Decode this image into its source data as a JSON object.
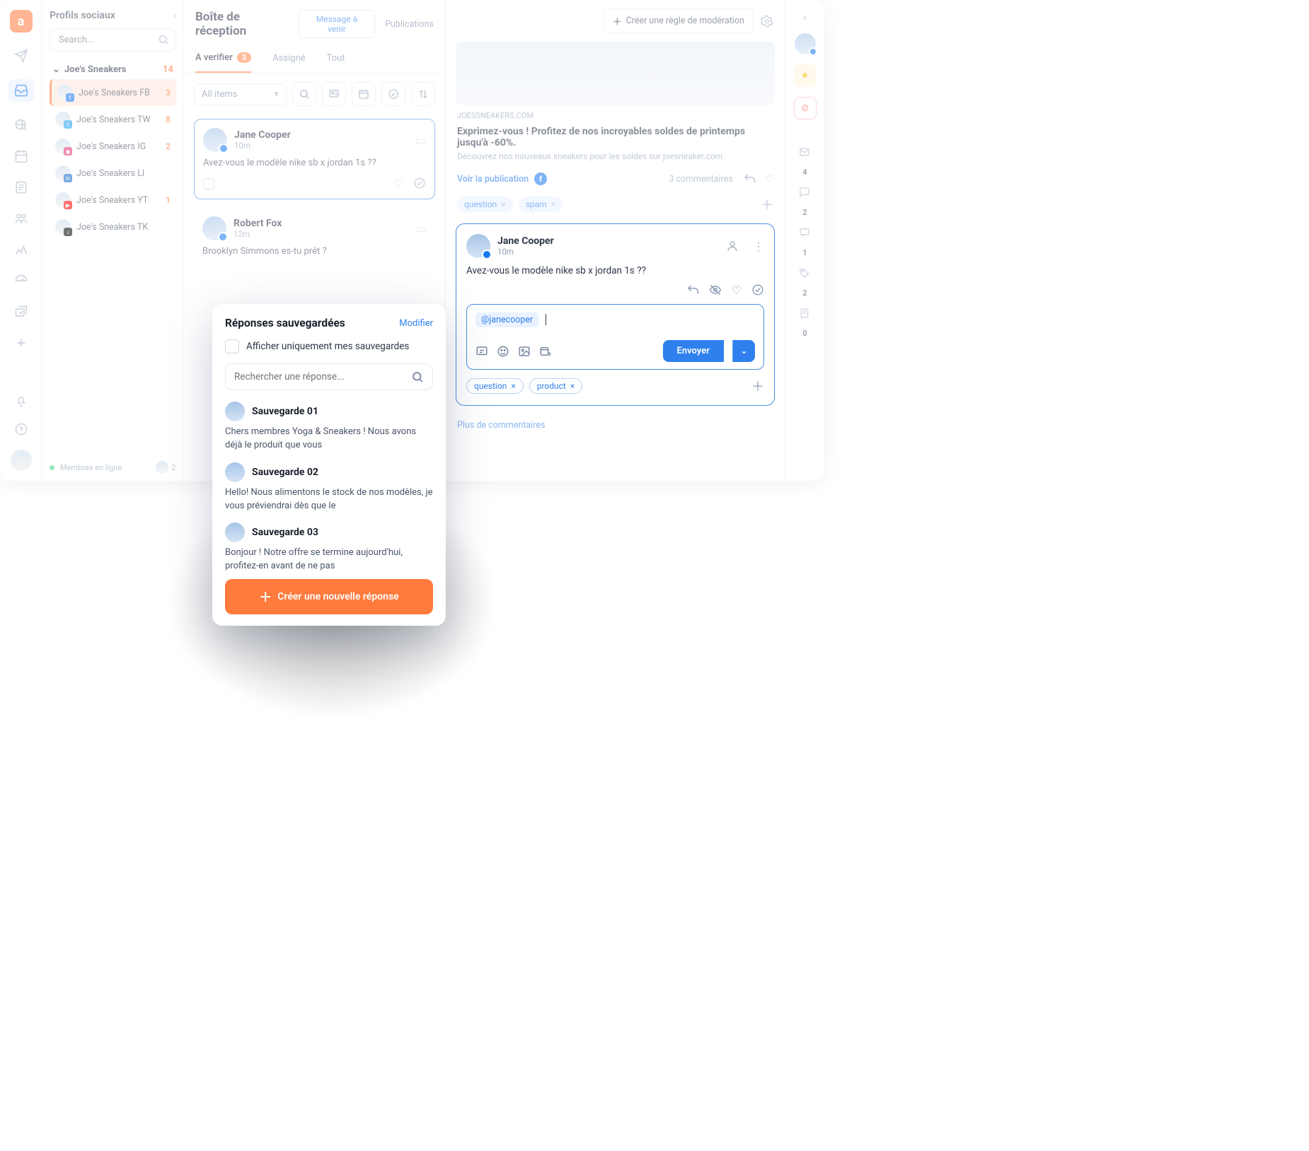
{
  "sidebar": {
    "title": "Profils sociaux",
    "search_placeholder": "Search...",
    "group": {
      "name": "Joe's Sneakers",
      "count": "14"
    },
    "items": [
      {
        "label": "Joe's Sneakers FB",
        "count": "3",
        "net": "fb"
      },
      {
        "label": "Joe's Sneakers TW",
        "count": "8",
        "net": "tw"
      },
      {
        "label": "Joe's Sneakers IG",
        "count": "2",
        "net": "ig"
      },
      {
        "label": "Joe's Sneakers LI",
        "count": "",
        "net": "li"
      },
      {
        "label": "Joe's Sneakers YT",
        "count": "1",
        "net": "yt"
      },
      {
        "label": "Joe's Sneakers TK",
        "count": "",
        "net": "tk"
      }
    ],
    "members_label": "Membres en ligne",
    "members_count": "2"
  },
  "header": {
    "title": "Boîte de réception",
    "btn_upcoming": "Message à venir",
    "tab_publications": "Publications",
    "btn_rule": "Créer une règle de modération"
  },
  "tabs": {
    "verify": "A verifier",
    "verify_count": "3",
    "assigned": "Assigné",
    "all": "Tout"
  },
  "filter": {
    "all_items": "All items"
  },
  "messages": [
    {
      "name": "Jane Cooper",
      "time": "10m",
      "text": "Avez-vous le modèle nike sb x jordan 1s ??"
    },
    {
      "name": "Robert Fox",
      "time": "12m",
      "text": "Brooklyn Simmons es-tu prêt ?"
    }
  ],
  "post": {
    "domain": "JOESSNEAKERS.COM",
    "title": "Exprimez-vous ! Profitez de nos incroyables soldes de printemps jusqu'à -60%.",
    "subtitle": "Découvrez nos nouveaux sneakers pour les soldes sur joesneaker.com",
    "see_post": "Voir la publication",
    "comments_count": "3 commentaires",
    "tags": [
      "question",
      "spam"
    ]
  },
  "comment": {
    "name": "Jane Cooper",
    "time": "10m",
    "text": "Avez-vous le modèle nike sb x jordan 1s ??",
    "mention": "@janecooper",
    "send": "Envoyer",
    "tags": [
      "question",
      "product"
    ],
    "more": "Plus de commentaires"
  },
  "rrail": {
    "n1": "4",
    "n2": "2",
    "n3": "1",
    "n4": "2",
    "n5": "0"
  },
  "popover": {
    "title": "Réponses sauvegardées",
    "edit": "Modifier",
    "only_mine": "Afficher uniquement mes sauvegardes",
    "search_placeholder": "Rechercher une réponse...",
    "items": [
      {
        "title": "Sauvegarde 01",
        "text": "Chers membres Yoga & Sneakers ! Nous avons déjà le produit que vous"
      },
      {
        "title": "Sauvegarde 02",
        "text": "Hello! Nous alimentons le stock de nos modèles, je vous préviendrai dès que le"
      },
      {
        "title": "Sauvegarde 03",
        "text": "Bonjour ! Notre offre se termine aujourd'hui, profitez-en avant de ne pas"
      }
    ],
    "create": "Créer une nouvelle réponse"
  }
}
